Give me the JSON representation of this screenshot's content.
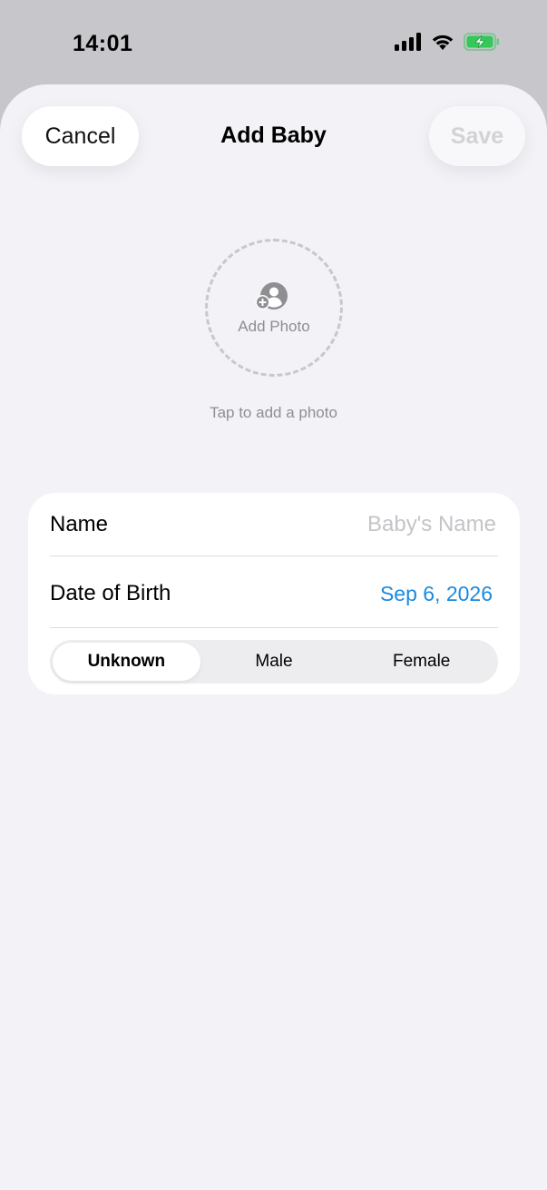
{
  "status_bar": {
    "time": "14:01",
    "icons": [
      "cellular-signal-icon",
      "wifi-icon",
      "battery-charging-icon"
    ],
    "battery_color": "#34c759"
  },
  "nav": {
    "cancel_label": "Cancel",
    "title": "Add Baby",
    "save_label": "Save"
  },
  "photo": {
    "icon": "add-person-photo-icon",
    "label": "Add Photo",
    "hint": "Tap to add a photo"
  },
  "form": {
    "name_label": "Name",
    "name_value": "",
    "name_placeholder": "Baby's Name",
    "dob_label": "Date of Birth",
    "dob_value": "Sep 6, 2026",
    "gender_options": [
      "Unknown",
      "Male",
      "Female"
    ],
    "gender_selected": "Unknown"
  },
  "colors": {
    "accent": "#1a8ae0",
    "sheet_background": "#f2f2f7",
    "placeholder": "#c4c4c9"
  }
}
